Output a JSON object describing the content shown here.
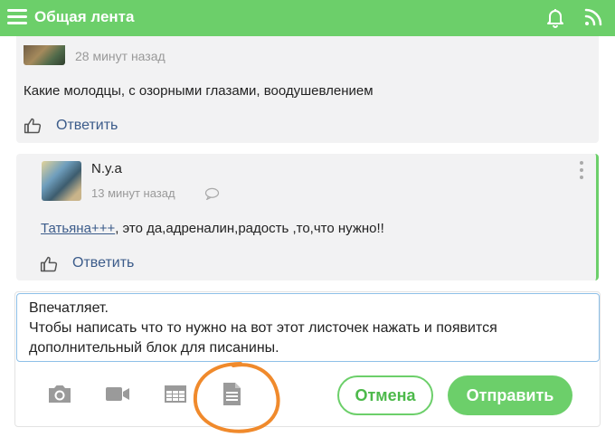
{
  "header": {
    "title": "Общая лента",
    "icons": [
      "menu-icon",
      "bell-icon",
      "rss-icon"
    ],
    "color": "#6ccf6a"
  },
  "comments": [
    {
      "time": "28 минут назад",
      "text": "Какие молодцы, с озорными глазами, воодушевлением",
      "reply_label": "Ответить"
    },
    {
      "author": "N.y.a",
      "time": "13 минут назад",
      "mention": "Татьяна+++",
      "text": ", это да,адреналин,радость ,то,что нужно!!",
      "reply_label": "Ответить"
    }
  ],
  "editor": {
    "line1": "Впечатляет.",
    "line2": "Чтобы написать что то нужно на вот этот листочек нажать и появится",
    "line3": "дополнительный блок для писанины.",
    "tools": [
      "camera-icon",
      "video-icon",
      "table-icon",
      "document-icon"
    ],
    "cancel_label": "Отмена",
    "send_label": "Отправить"
  },
  "annotation_color": "#f08a2c"
}
